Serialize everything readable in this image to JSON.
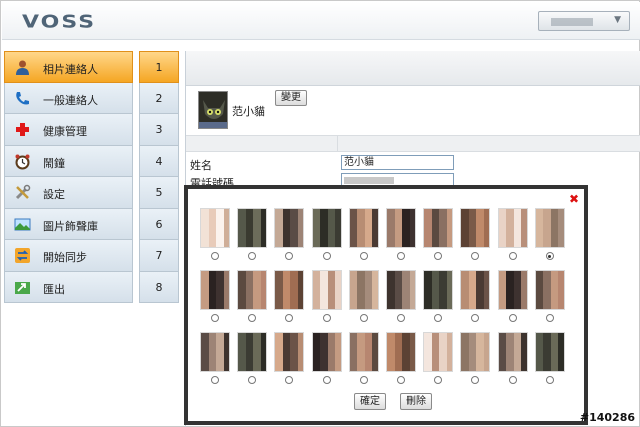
{
  "header": {
    "logo": "VOSS",
    "user_menu_icon": "chevron-down-icon"
  },
  "sidebar": {
    "items": [
      {
        "label": "相片連絡人",
        "icon": "user-icon",
        "num": "1",
        "active": true
      },
      {
        "label": "一般連絡人",
        "icon": "phone-icon",
        "num": "2",
        "active": false
      },
      {
        "label": "健康管理",
        "icon": "red-cross-icon",
        "num": "3",
        "active": false
      },
      {
        "label": "鬧鐘",
        "icon": "alarm-clock-icon",
        "num": "4",
        "active": false
      },
      {
        "label": "設定",
        "icon": "tools-icon",
        "num": "5",
        "active": false
      },
      {
        "label": "圖片飾聲庫",
        "icon": "image-icon",
        "num": "6",
        "active": false
      },
      {
        "label": "開始同步",
        "icon": "sync-icon",
        "num": "7",
        "active": false
      },
      {
        "label": "匯出",
        "icon": "export-icon",
        "num": "8",
        "active": false
      }
    ]
  },
  "contact": {
    "name_display": "范小貓",
    "change_label": "變更",
    "fields": [
      {
        "label": "姓名",
        "value": "范小貓"
      },
      {
        "label": "電話號碼",
        "value": ""
      }
    ]
  },
  "photo_picker": {
    "close_icon": "close-icon",
    "selected_index": 9,
    "confirm_label": "確定",
    "delete_label": "刪除",
    "photo_count": 30
  },
  "watermark": "#140286",
  "colors": {
    "active_tab": "#f5a623",
    "nav_bg": "#dfe8f0",
    "modal_border": "#333333",
    "close": "#dd1111"
  }
}
